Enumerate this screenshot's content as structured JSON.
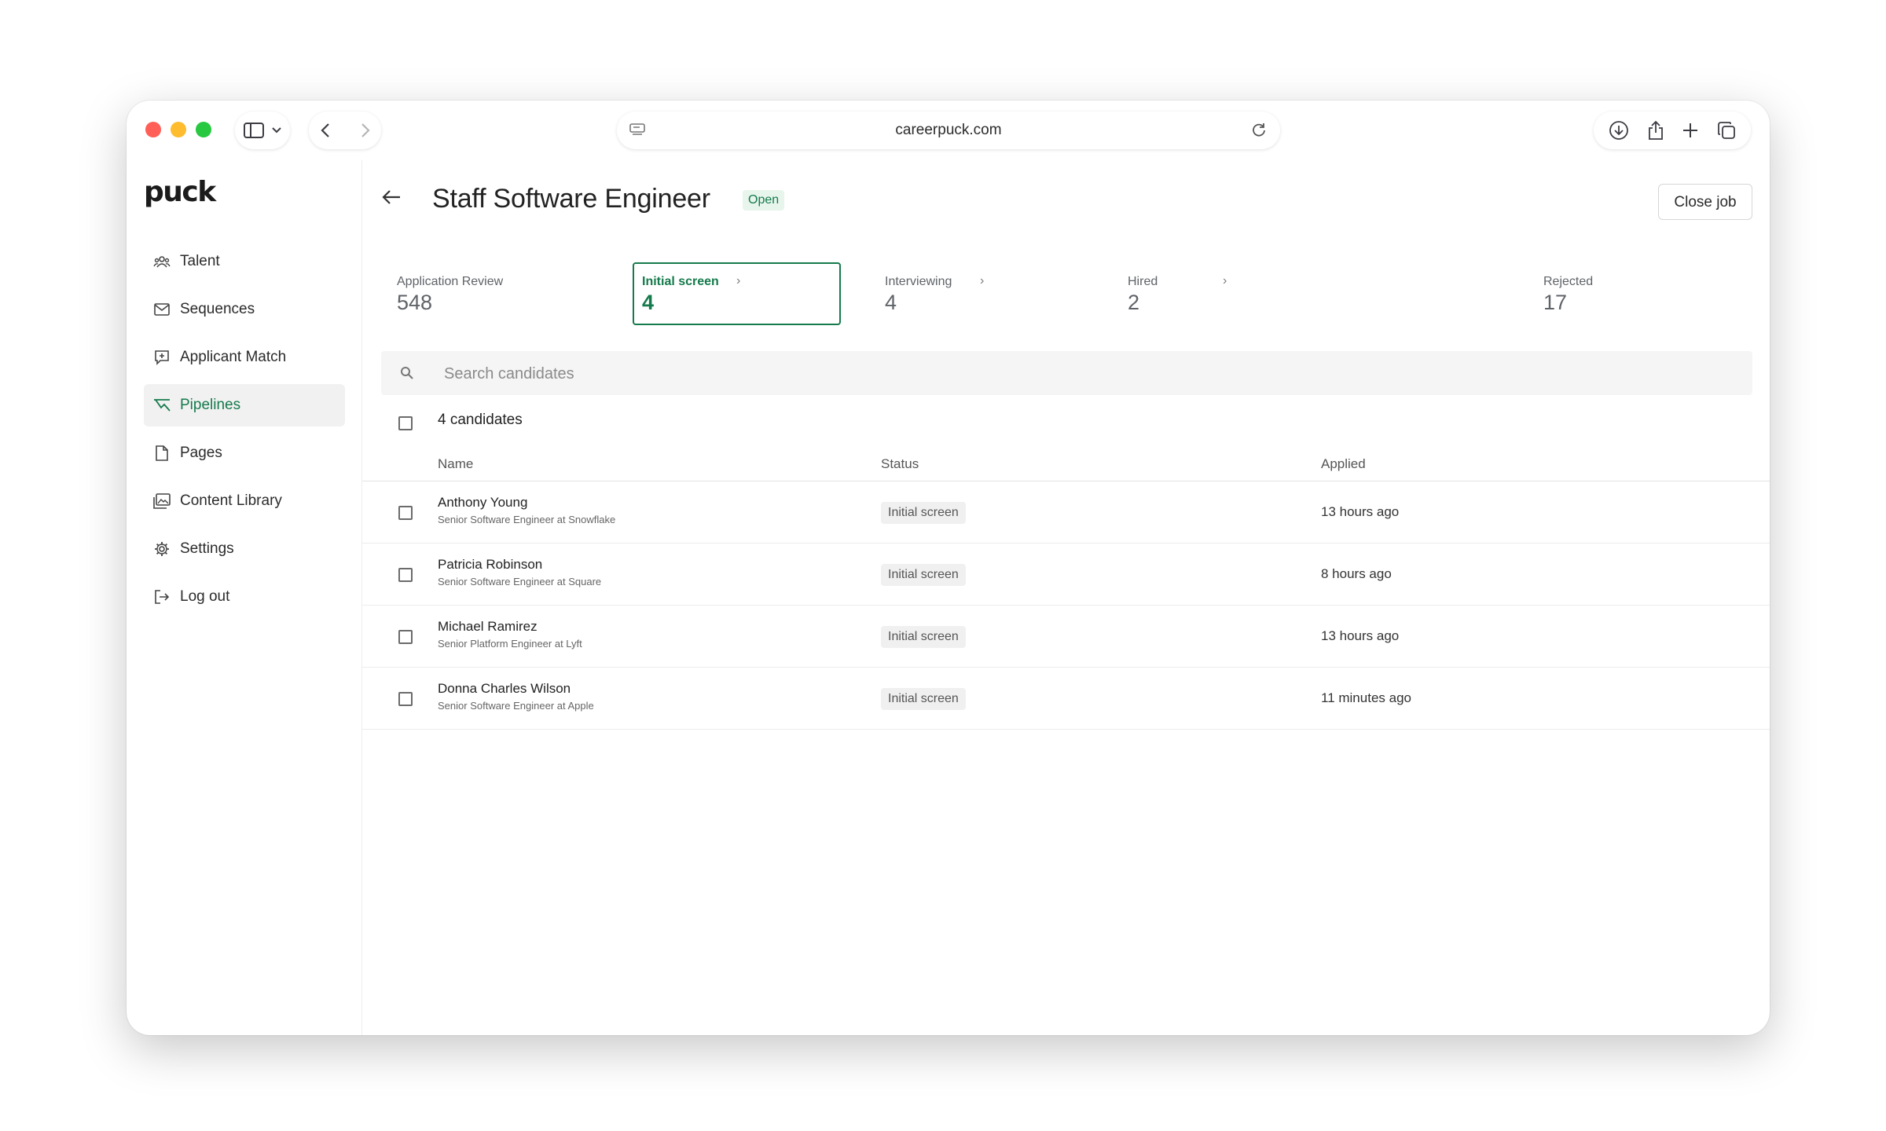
{
  "browser": {
    "url": "careerpuck.com"
  },
  "sidebar": {
    "logo": "puck",
    "items": [
      {
        "label": "Talent",
        "icon": "users-icon",
        "active": false
      },
      {
        "label": "Sequences",
        "icon": "mail-icon",
        "active": false
      },
      {
        "label": "Applicant Match",
        "icon": "match-icon",
        "active": false
      },
      {
        "label": "Pipelines",
        "icon": "pipeline-icon",
        "active": true
      },
      {
        "label": "Pages",
        "icon": "page-icon",
        "active": false
      },
      {
        "label": "Content Library",
        "icon": "library-icon",
        "active": false
      },
      {
        "label": "Settings",
        "icon": "gear-icon",
        "active": false
      },
      {
        "label": "Log out",
        "icon": "logout-icon",
        "active": false
      }
    ]
  },
  "job": {
    "title": "Staff Software Engineer",
    "status_badge": "Open",
    "close_label": "Close job"
  },
  "stages": [
    {
      "label": "Application Review",
      "count": "548",
      "selected": false
    },
    {
      "label": "Initial screen",
      "count": "4",
      "selected": true
    },
    {
      "label": "Interviewing",
      "count": "4",
      "selected": false
    },
    {
      "label": "Hired",
      "count": "2",
      "selected": false
    },
    {
      "label": "Rejected",
      "count": "17",
      "selected": false
    }
  ],
  "search": {
    "placeholder": "Search candidates"
  },
  "table": {
    "count_label": "4 candidates",
    "columns": [
      "Name",
      "Status",
      "Applied"
    ],
    "rows": [
      {
        "name": "Anthony Young",
        "subtitle": "Senior Software Engineer at Snowflake",
        "status": "Initial screen",
        "applied": "13 hours ago"
      },
      {
        "name": "Patricia Robinson",
        "subtitle": "Senior Software Engineer at Square",
        "status": "Initial screen",
        "applied": "8 hours ago"
      },
      {
        "name": "Michael Ramirez",
        "subtitle": "Senior Platform Engineer at Lyft",
        "status": "Initial screen",
        "applied": "13 hours ago"
      },
      {
        "name": "Donna Charles Wilson",
        "subtitle": "Senior Software Engineer at Apple",
        "status": "Initial screen",
        "applied": "11 minutes ago"
      }
    ]
  },
  "colors": {
    "accent": "#157a4c",
    "badge_bg": "#e7f5ec",
    "active_nav_bg": "#f1f1f1"
  }
}
